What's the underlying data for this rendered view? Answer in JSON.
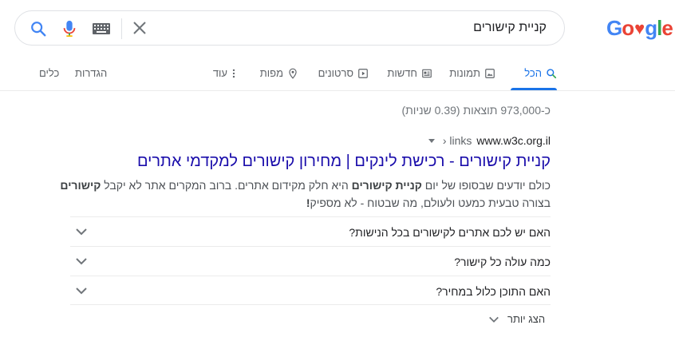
{
  "logo": {
    "text_before": "Go",
    "text_after": "gle",
    "heart": "♥",
    "colors": [
      "#4285f4",
      "#ea4335",
      "#fbbc05",
      "#4285f4",
      "#34a853",
      "#ea4335"
    ]
  },
  "search": {
    "query": "קניית קישורים"
  },
  "tabs": [
    {
      "label": "הכל",
      "icon": "search-icon",
      "active": true
    },
    {
      "label": "תמונות",
      "icon": "image-icon"
    },
    {
      "label": "חדשות",
      "icon": "news-icon"
    },
    {
      "label": "סרטונים",
      "icon": "video-icon"
    },
    {
      "label": "מפות",
      "icon": "map-pin-icon"
    },
    {
      "label": "עוד",
      "icon": "more-vert-icon"
    }
  ],
  "tools": {
    "settings": "הגדרות",
    "tools": "כלים"
  },
  "stats": "כ-973,000 תוצאות (0.39 שניות)",
  "result": {
    "domain": "www.w3c.org.il",
    "breadcrumb": "› links",
    "title": "קניית קישורים - רכישת לינקים | מחירון קישורים למקדמי אתרים",
    "snippet_line1_pre": "כולם יודעים שבסופו של יום ",
    "snippet_bold1": "קניית קישורים",
    "snippet_line1_mid": " היא חלק מקידום אתרים. ברוב המקרים אתר לא יקבל ",
    "snippet_bold2": "קישורים",
    "snippet_line2": "בצורה טבעית כמעט ולעולם, מה שבטוח - לא מספיק",
    "snippet_bold3": "!"
  },
  "faq": [
    "האם יש לכם אתרים לקישורים בכל הנישות?",
    "כמה עולה כל קישור?",
    "האם התוכן כלול במחיר?"
  ],
  "show_more": "הצג יותר",
  "colors": {
    "link": "#1a0dab",
    "accent": "#1a73e8"
  }
}
